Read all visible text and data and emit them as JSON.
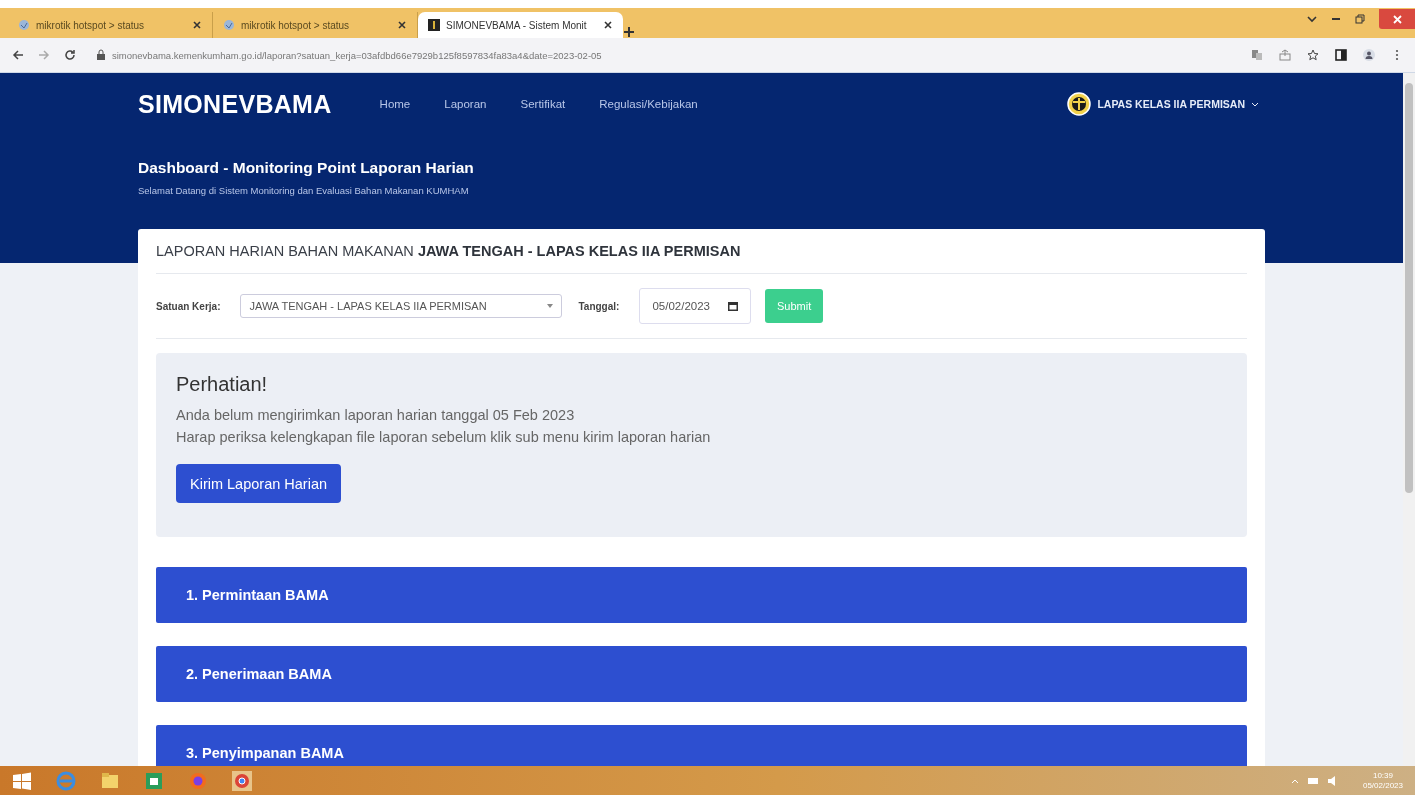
{
  "browser": {
    "tabs": [
      {
        "title": "mikrotik hotspot > status",
        "selected": false
      },
      {
        "title": "mikrotik hotspot > status",
        "selected": false
      },
      {
        "title": "SIMONEVBAMA - Sistem Monit",
        "selected": true
      }
    ],
    "url": "simonevbama.kemenkumham.go.id/laporan?satuan_kerja=03afdbd66e7929b125f8597834fa83a4&date=2023-02-05"
  },
  "navbar": {
    "brand": "SIMONEVBAMA",
    "links": [
      "Home",
      "Laporan",
      "Sertifikat",
      "Regulasi/Kebijakan"
    ],
    "user": "LAPAS KELAS IIA PERMISAN"
  },
  "header": {
    "title": "Dashboard - Monitoring Point Laporan Harian",
    "subtitle": "Selamat Datang di Sistem Monitoring dan Evaluasi Bahan Makanan KUMHAM"
  },
  "card": {
    "title": "LAPORAN HARIAN BAHAN MAKANAN **JAWA TENGAH - LAPAS KELAS IIA PERMISAN**",
    "filter": {
      "unit_label": "Satuan Kerja:",
      "unit_value": "JAWA TENGAH - LAPAS KELAS IIA PERMISAN",
      "date_label": "Tanggal:",
      "date_value": "05/02/2023",
      "submit": "Submit"
    },
    "alert": {
      "heading": "Perhatian!",
      "lines": [
        "Anda belum mengirimkan laporan harian tanggal 05 Feb 2023",
        "Harap periksa kelengkapan file laporan sebelum klik sub menu kirim laporan harian"
      ],
      "button": "Kirim Laporan Harian"
    },
    "sections": [
      "1. Permintaan BAMA",
      "2. Penerimaan BAMA",
      "3. Penyimpanan BAMA"
    ]
  },
  "taskbar": {
    "time": "10:39",
    "date": "05/02/2023"
  }
}
